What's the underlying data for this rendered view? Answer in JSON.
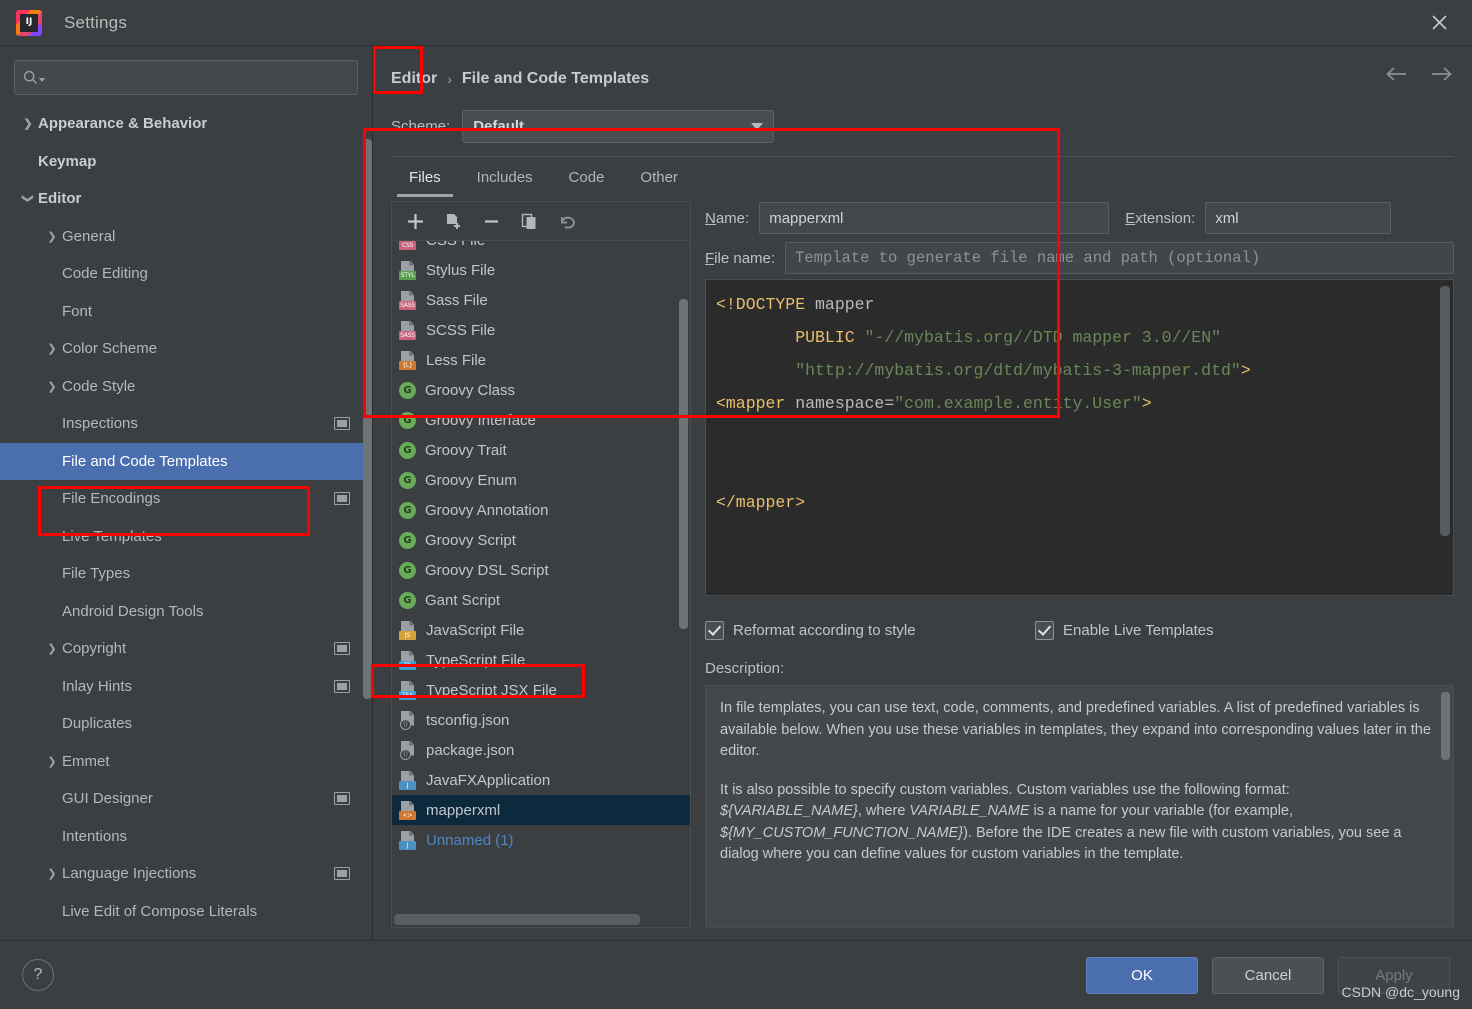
{
  "window": {
    "title": "Settings",
    "logo_text": "IJ",
    "close_icon": "close-icon"
  },
  "sidebar": {
    "search": {
      "value": "",
      "placeholder": ""
    },
    "items": [
      {
        "label": "Appearance & Behavior",
        "level": 0,
        "chevron": "right",
        "bold": true,
        "badge": false,
        "selected": false
      },
      {
        "label": "Keymap",
        "level": 0,
        "chevron": "none",
        "bold": true,
        "badge": false,
        "selected": false
      },
      {
        "label": "Editor",
        "level": 0,
        "chevron": "down",
        "bold": true,
        "badge": false,
        "selected": false
      },
      {
        "label": "General",
        "level": 1,
        "chevron": "right",
        "bold": false,
        "badge": false,
        "selected": false
      },
      {
        "label": "Code Editing",
        "level": 1,
        "chevron": "none",
        "bold": false,
        "badge": false,
        "selected": false
      },
      {
        "label": "Font",
        "level": 1,
        "chevron": "none",
        "bold": false,
        "badge": false,
        "selected": false
      },
      {
        "label": "Color Scheme",
        "level": 1,
        "chevron": "right",
        "bold": false,
        "badge": false,
        "selected": false
      },
      {
        "label": "Code Style",
        "level": 1,
        "chevron": "right",
        "bold": false,
        "badge": false,
        "selected": false
      },
      {
        "label": "Inspections",
        "level": 1,
        "chevron": "none",
        "bold": false,
        "badge": true,
        "selected": false
      },
      {
        "label": "File and Code Templates",
        "level": 1,
        "chevron": "none",
        "bold": false,
        "badge": false,
        "selected": true
      },
      {
        "label": "File Encodings",
        "level": 1,
        "chevron": "none",
        "bold": false,
        "badge": true,
        "selected": false
      },
      {
        "label": "Live Templates",
        "level": 1,
        "chevron": "none",
        "bold": false,
        "badge": false,
        "selected": false
      },
      {
        "label": "File Types",
        "level": 1,
        "chevron": "none",
        "bold": false,
        "badge": false,
        "selected": false
      },
      {
        "label": "Android Design Tools",
        "level": 1,
        "chevron": "none",
        "bold": false,
        "badge": false,
        "selected": false
      },
      {
        "label": "Copyright",
        "level": 1,
        "chevron": "right",
        "bold": false,
        "badge": true,
        "selected": false
      },
      {
        "label": "Inlay Hints",
        "level": 1,
        "chevron": "none",
        "bold": false,
        "badge": true,
        "selected": false
      },
      {
        "label": "Duplicates",
        "level": 1,
        "chevron": "none",
        "bold": false,
        "badge": false,
        "selected": false
      },
      {
        "label": "Emmet",
        "level": 1,
        "chevron": "right",
        "bold": false,
        "badge": false,
        "selected": false
      },
      {
        "label": "GUI Designer",
        "level": 1,
        "chevron": "none",
        "bold": false,
        "badge": true,
        "selected": false
      },
      {
        "label": "Intentions",
        "level": 1,
        "chevron": "none",
        "bold": false,
        "badge": false,
        "selected": false
      },
      {
        "label": "Language Injections",
        "level": 1,
        "chevron": "right",
        "bold": false,
        "badge": true,
        "selected": false
      },
      {
        "label": "Live Edit of Compose Literals",
        "level": 1,
        "chevron": "none",
        "bold": false,
        "badge": false,
        "selected": false
      }
    ]
  },
  "breadcrumb": {
    "root": "Editor",
    "separator": "›",
    "current": "File and Code Templates"
  },
  "nav": {
    "back_icon": "arrow-left-icon",
    "forward_icon": "arrow-right-icon"
  },
  "scheme": {
    "label": "Scheme:",
    "value": "Default"
  },
  "tabs": [
    {
      "label": "Files",
      "active": true
    },
    {
      "label": "Includes",
      "active": false
    },
    {
      "label": "Code",
      "active": false
    },
    {
      "label": "Other",
      "active": false
    }
  ],
  "list_toolbar": [
    {
      "name": "add-template-button",
      "glyph": "+"
    },
    {
      "name": "copy-template-button",
      "glyph": "file-plus-icon"
    },
    {
      "name": "remove-template-button",
      "glyph": "−"
    },
    {
      "name": "duplicate-template-button",
      "glyph": "copy-icon"
    },
    {
      "name": "reset-template-button",
      "glyph": "undo-icon"
    }
  ],
  "template_list": [
    {
      "label": "CSS File",
      "icon": "css-file-icon",
      "tag": "CSS",
      "tag_color": "#c9637b",
      "selected": false
    },
    {
      "label": "Stylus File",
      "icon": "stylus-file-icon",
      "tag": "STYL",
      "tag_color": "#5a9e4f",
      "selected": false
    },
    {
      "label": "Sass File",
      "icon": "sass-file-icon",
      "tag": "SASS",
      "tag_color": "#c9637b",
      "selected": false
    },
    {
      "label": "SCSS File",
      "icon": "scss-file-icon",
      "tag": "SASS",
      "tag_color": "#c9637b",
      "selected": false
    },
    {
      "label": "Less File",
      "icon": "less-file-icon",
      "tag": "{L}",
      "tag_color": "#cc7832",
      "selected": false
    },
    {
      "label": "Groovy Class",
      "icon": "groovy-icon",
      "tag": "G",
      "tag_color": "#6aab5a",
      "selected": false
    },
    {
      "label": "Groovy Interface",
      "icon": "groovy-icon",
      "tag": "G",
      "tag_color": "#6aab5a",
      "selected": false
    },
    {
      "label": "Groovy Trait",
      "icon": "groovy-icon",
      "tag": "G",
      "tag_color": "#6aab5a",
      "selected": false
    },
    {
      "label": "Groovy Enum",
      "icon": "groovy-icon",
      "tag": "G",
      "tag_color": "#6aab5a",
      "selected": false
    },
    {
      "label": "Groovy Annotation",
      "icon": "groovy-icon",
      "tag": "G",
      "tag_color": "#6aab5a",
      "selected": false
    },
    {
      "label": "Groovy Script",
      "icon": "groovy-icon",
      "tag": "G",
      "tag_color": "#6aab5a",
      "selected": false
    },
    {
      "label": "Groovy DSL Script",
      "icon": "groovy-icon",
      "tag": "G",
      "tag_color": "#6aab5a",
      "selected": false
    },
    {
      "label": "Gant Script",
      "icon": "groovy-icon",
      "tag": "G",
      "tag_color": "#6aab5a",
      "selected": false
    },
    {
      "label": "JavaScript File",
      "icon": "javascript-file-icon",
      "tag": "JS",
      "tag_color": "#d4a23c",
      "selected": false
    },
    {
      "label": "TypeScript File",
      "icon": "typescript-file-icon",
      "tag": "TS",
      "tag_color": "#3c9cd4",
      "selected": false
    },
    {
      "label": "TypeScript JSX File",
      "icon": "typescript-jsx-file-icon",
      "tag": "TSX",
      "tag_color": "#3c9cd4",
      "selected": false
    },
    {
      "label": "tsconfig.json",
      "icon": "json-file-icon",
      "tag": "JSON",
      "tag_color": "#6d7479",
      "selected": false
    },
    {
      "label": "package.json",
      "icon": "json-file-icon",
      "tag": "JSON",
      "tag_color": "#6d7479",
      "selected": false
    },
    {
      "label": "JavaFXApplication",
      "icon": "java-file-icon",
      "tag": "J",
      "tag_color": "#4a90c0",
      "selected": false
    },
    {
      "label": "mapperxml",
      "icon": "xml-file-icon",
      "tag": "<>",
      "tag_color": "#cc7832",
      "selected": true
    },
    {
      "label": "Unnamed (1)",
      "icon": "java-file-icon",
      "tag": "J",
      "tag_color": "#4a90c0",
      "selected": false,
      "unnamed": true
    }
  ],
  "detail": {
    "name_label": "Name:",
    "name_value": "mapperxml",
    "extension_label": "Extension:",
    "extension_value": "xml",
    "filename_label": "File name:",
    "filename_value": "",
    "filename_placeholder": "Template to generate file name and path (optional)"
  },
  "code": {
    "lines": [
      "<!DOCTYPE mapper",
      "        PUBLIC \"-//mybatis.org//DTD mapper 3.0//EN\"",
      "        \"http://mybatis.org/dtd/mybatis-3-mapper.dtd\">",
      "<mapper namespace=\"com.example.entity.User\">",
      "",
      "",
      "</mapper>"
    ]
  },
  "options": {
    "reformat": {
      "label": "Reformat according to style",
      "checked": true
    },
    "live_templates": {
      "label": "Enable Live Templates",
      "checked": true
    }
  },
  "description": {
    "label": "Description:",
    "paragraph1": "In file templates, you can use text, code, comments, and predefined variables. A list of predefined variables is available below. When you use these variables in templates, they expand into corresponding values later in the editor.",
    "paragraph2_pre": "It is also possible to specify custom variables. Custom variables use the following format: ",
    "var1": "${VARIABLE_NAME}",
    "paragraph2_mid": ", where ",
    "var2": "VARIABLE_NAME",
    "paragraph2_mid2": " is a name for your variable (for example, ",
    "var3": "${MY_CUSTOM_FUNCTION_NAME}",
    "paragraph2_post": "). Before the IDE creates a new file with custom variables, you see a dialog where you can define values for custom variables in the template."
  },
  "footer": {
    "help_label": "?",
    "ok_label": "OK",
    "cancel_label": "Cancel",
    "apply_label": "Apply",
    "watermark": "CSDN @dc_young"
  },
  "colors": {
    "accent": "#4b6eaf",
    "selection_list": "#0d293e",
    "highlight_box": "#ff0000",
    "window_bg": "#3c3f41",
    "editor_bg": "#2b2b2b",
    "link": "#4a88c7"
  }
}
